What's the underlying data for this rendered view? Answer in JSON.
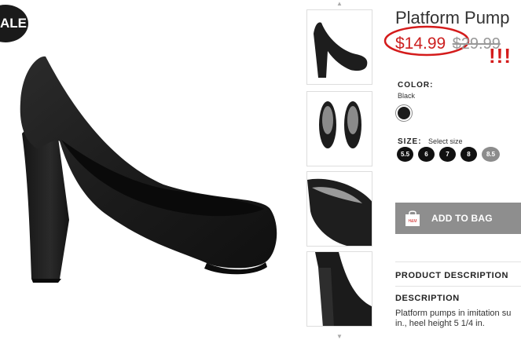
{
  "badge": {
    "sale": "ALE"
  },
  "product": {
    "title": "Platform Pump",
    "price_sale": "$14.99",
    "price_original": "$29.99",
    "annotation": "!!!",
    "color_label": "COLOR:",
    "color_value": "Black",
    "swatch_color": "#1c1c1c",
    "size_label": "SIZE:",
    "size_hint": "Select size",
    "sizes": [
      {
        "label": "5.5",
        "available": true
      },
      {
        "label": "6",
        "available": true
      },
      {
        "label": "7",
        "available": true
      },
      {
        "label": "8",
        "available": true
      },
      {
        "label": "8.5",
        "available": false
      }
    ],
    "add_to_bag": "ADD TO BAG",
    "bag_icon_text": "H&M"
  },
  "sections": {
    "product_description": "PRODUCT DESCRIPTION",
    "description_heading": "DESCRIPTION",
    "description_text": "Platform pumps in imitation su in., heel height 5 1/4 in."
  },
  "icons": {
    "thumb_prev": "chevron-up-icon",
    "thumb_next": "chevron-down-icon",
    "bag": "shopping-bag-icon"
  },
  "colors": {
    "sale_red": "#cc1f1f",
    "button_gray": "#8e8e8e"
  }
}
